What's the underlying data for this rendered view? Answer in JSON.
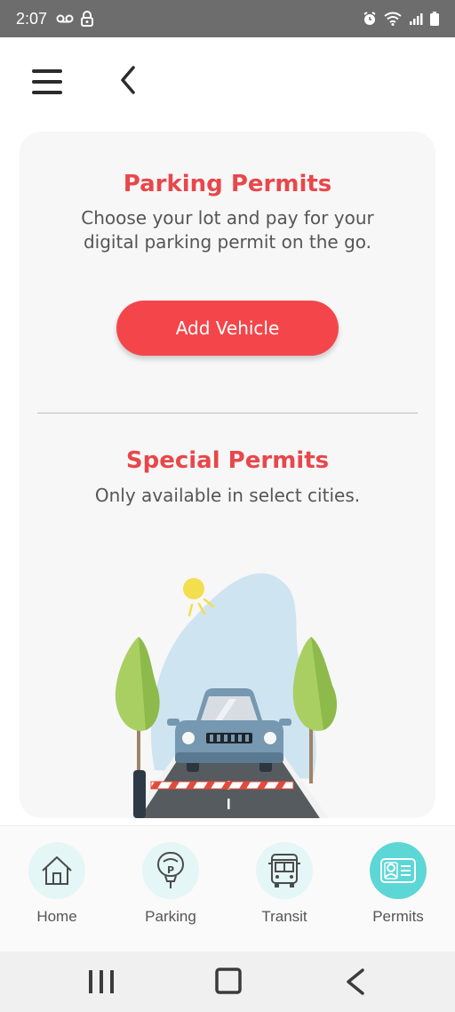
{
  "status_bar": {
    "time": "2:07",
    "left_icons": [
      "voicemail-icon",
      "lock-icon"
    ],
    "right_icons": [
      "alarm-icon",
      "wifi-icon",
      "signal-icon",
      "battery-icon"
    ]
  },
  "app_bar": {
    "icons": [
      "menu-icon",
      "back-arrow-icon"
    ]
  },
  "parking_permits": {
    "title": "Parking Permits",
    "description_line1": "Choose your lot and pay for your",
    "description_line2": "digital parking permit on the go.",
    "button_label": "Add Vehicle"
  },
  "special_permits": {
    "title": "Special Permits",
    "description": "Only available in select cities."
  },
  "illustration": {
    "name": "car-at-parking-gate-illustration"
  },
  "tabs": [
    {
      "label": "Home",
      "icon": "house-icon",
      "active": false
    },
    {
      "label": "Parking",
      "icon": "parking-meter-icon",
      "active": false
    },
    {
      "label": "Transit",
      "icon": "bus-icon",
      "active": false
    },
    {
      "label": "Permits",
      "icon": "id-card-icon",
      "active": true
    }
  ],
  "system_nav": {
    "icons": [
      "recents-icon",
      "home-square-icon",
      "back-chevron-icon"
    ]
  },
  "colors": {
    "accent": "#f4464a",
    "title": "#e8474b",
    "tab_bg": "#e4f6f6",
    "tab_active": "#5dd6d6",
    "status_bar": "#6d6d6d"
  }
}
